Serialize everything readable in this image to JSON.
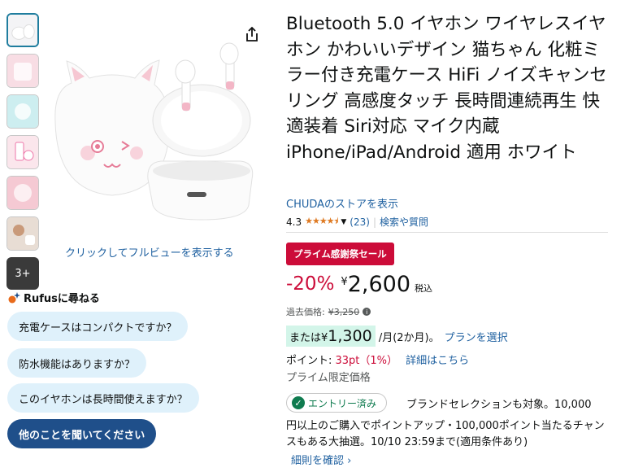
{
  "gallery": {
    "thumbnails": [
      "thumb-1",
      "thumb-2",
      "thumb-3",
      "thumb-4",
      "thumb-5",
      "thumb-6"
    ],
    "more_label": "3+",
    "fullview_link": "クリックしてフルビューを表示する"
  },
  "rufus": {
    "title": "Rufusに尋ねる",
    "questions": [
      "充電ケースはコンパクトですか？",
      "防水機能はありますか？",
      "このイヤホンは長時間使えますか？"
    ],
    "ask_other": "他のことを聞いてください"
  },
  "product": {
    "title": "Bluetooth 5.0 イヤホン ワイヤレスイヤホン かわいいデザイン 猫ちゃん 化粧ミラー付き充電ケース HiFi ノイズキャンセリング 高感度タッチ 長時間連続再生 快適装着 Siri対応 マイク内蔵 iPhone/iPad/Android 適用 ホワイト",
    "store_link": "CHUDAのストアを表示",
    "rating": "4.3",
    "stars": "★★★★⯨",
    "review_count": "(23)",
    "search_qa": "検索や質問"
  },
  "pricing": {
    "deal_badge": "プライム感謝祭セール",
    "discount": "-20%",
    "yen": "¥",
    "price": "2,600",
    "tax": "税込",
    "list_label": "過去価格:",
    "list_price": "¥3,250",
    "installment_prefix": "または",
    "installment_yen": "¥",
    "installment_amount": "1,300",
    "installment_suffix": " /月(2か月)。",
    "plan_link": "プランを選択",
    "points_label": "ポイント: ",
    "points_value": "33pt（1%）",
    "points_link": "詳細はこちら",
    "prime_only": "プライム限定価格"
  },
  "promo": {
    "entry_badge": "エントリー済み",
    "line1": "ブランドセレクションも対象。10,000",
    "rest": "円以上のご購入でポイントアップ・100,000ポイント当たるチャンスもある大抽選。10/10 23:59まで(適用条件あり)",
    "details_link": "細則を確認 ›"
  },
  "colors": {
    "link": "#2162a1",
    "deal": "#cc0c39",
    "rufus_chip": "#dff1fb",
    "rufus_primary": "#1f4f8a",
    "installment_highlight": "#d3f5e9",
    "entry_green": "#0f7b4f"
  }
}
